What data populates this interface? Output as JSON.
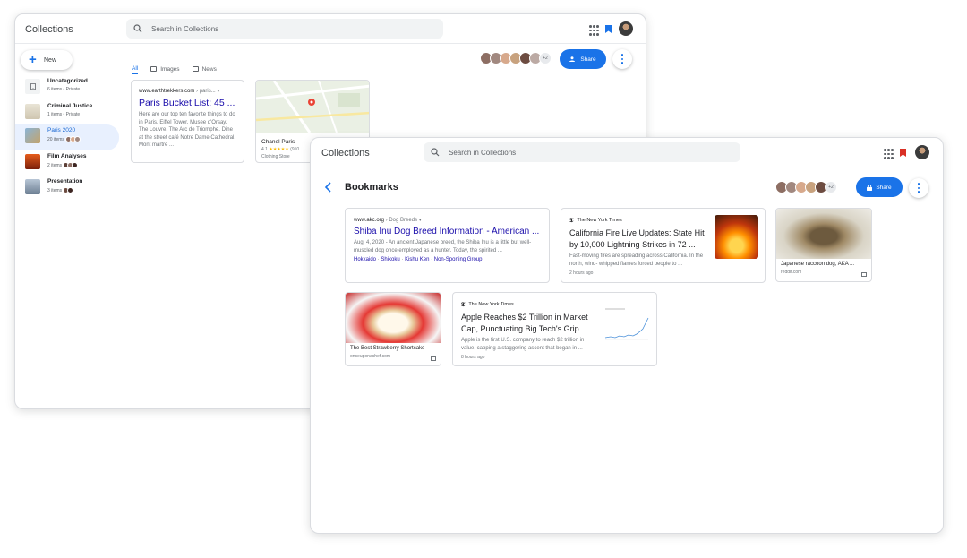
{
  "back_window": {
    "app_title": "Collections",
    "search_placeholder": "Search in Collections",
    "new_label": "New",
    "sidebar": [
      {
        "name": "Uncategorized",
        "sub": "6 items • Private"
      },
      {
        "name": "Criminal Justice",
        "sub": "1 items • Private"
      },
      {
        "name": "Paris 2020",
        "sub": "20 items •"
      },
      {
        "name": "Film Analyses",
        "sub": "2 items •"
      },
      {
        "name": "Presentation",
        "sub": "3 items •"
      }
    ],
    "tabs": [
      "All",
      "Images",
      "News"
    ],
    "more_count": "+2",
    "share_label": "Share",
    "card_paris": {
      "source": "www.earthtrekkers.com",
      "path": " › paris...",
      "title": "Paris Bucket List: 45 ...",
      "snippet": "Here are our top ten favorite things to do in Paris. Eiffel Tower. Musee d'Orsay. The Louvre. The Arc de Triomphe. Dine at the street café Notre Dame Cathedral. Mont martre ..."
    },
    "card_chanel": {
      "name": "Chanel Paris",
      "rating": "4.1",
      "stars": "★★★★★",
      "count": "(910",
      "category": "Clothing Store"
    }
  },
  "front_window": {
    "app_title": "Collections",
    "search_placeholder": "Search in Collections",
    "page_title": "Bookmarks",
    "more_count": "+2",
    "share_label": "Share",
    "card_akc": {
      "source": "www.akc.org",
      "path": " › Dog Breeds",
      "title": "Shiba Inu Dog Breed Information - American ...",
      "snippet": "Aug. 4, 2020 - An ancient Japanese breed, the Shiba Inu is a little but well-muscled dog once employed as a hunter. Today, the spirited ...",
      "tags": [
        "Hokkaido",
        "Shikoku",
        "Kishu Ken",
        "Non-Sporting Group"
      ]
    },
    "card_fire": {
      "publisher": "The New York Times",
      "title": "California Fire Live Updates: State Hit by 10,000 Lightning Strikes in 72 ...",
      "snippet": "Fast-moving fires are spreading across California. In the north, wind- whipped flames forced people to ...",
      "time": "2 hours ago"
    },
    "card_raccoon": {
      "caption": "Japanese raccoon dog, AKA ...",
      "domain": "reddit.com"
    },
    "card_shortcake": {
      "caption": "The Best Strawberry Shortcake",
      "domain": "onceuponachef.com"
    },
    "card_apple": {
      "publisher": "The New York Times",
      "title": "Apple Reaches $2 Trillion in Market Cap, Punctuating Big Tech's Grip",
      "snippet": "Apple is the first U.S. company to reach $2 trillion in value, capping a staggering ascent that began in ...",
      "time": "8 hours ago"
    }
  }
}
